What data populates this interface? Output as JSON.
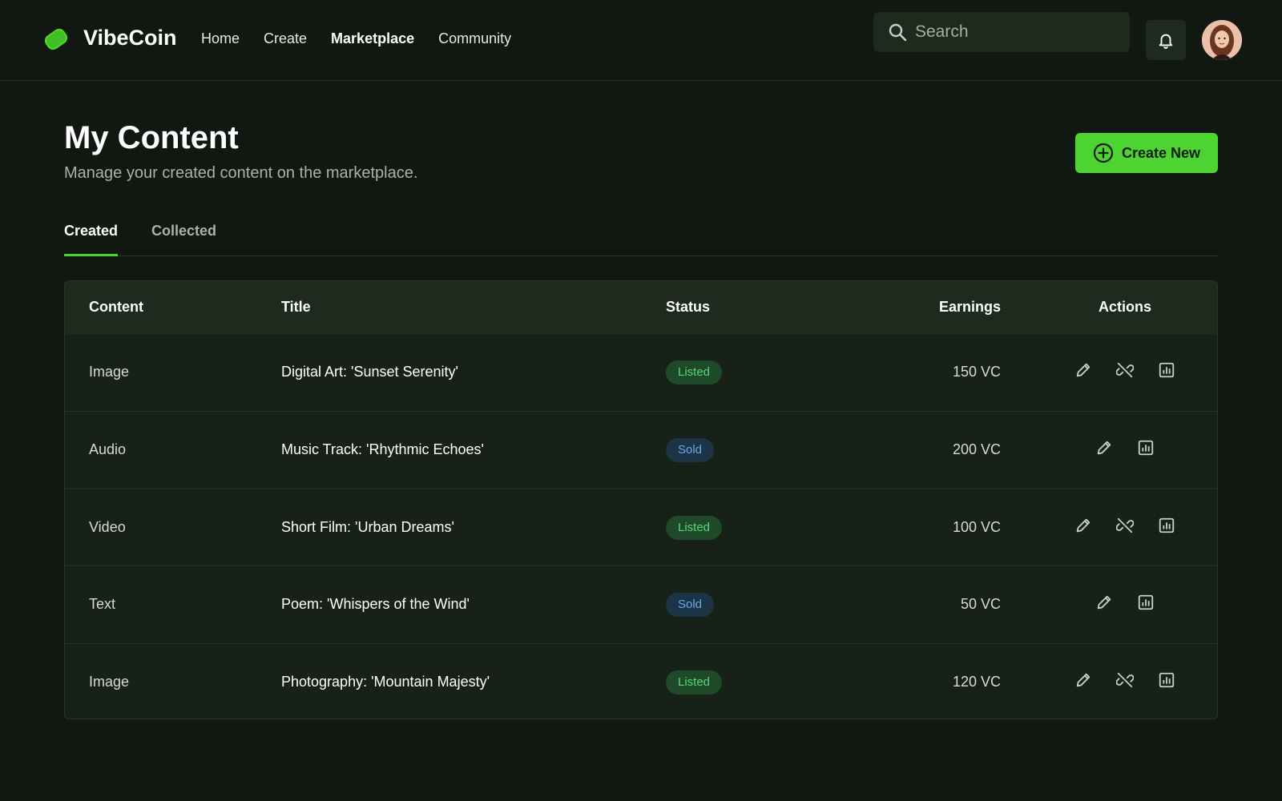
{
  "header": {
    "brand": "VibeCoin",
    "nav": [
      "Home",
      "Create",
      "Marketplace",
      "Community"
    ],
    "active_nav": "Marketplace",
    "search_placeholder": "Search"
  },
  "page": {
    "title": "My Content",
    "subtitle": "Manage your created content on the marketplace.",
    "create_label": "Create New"
  },
  "tabs": [
    {
      "label": "Created",
      "active": true
    },
    {
      "label": "Collected",
      "active": false
    }
  ],
  "table": {
    "columns": [
      "Content",
      "Title",
      "Status",
      "Earnings",
      "Actions"
    ],
    "rows": [
      {
        "content": "Image",
        "title": "Digital Art: 'Sunset Serenity'",
        "status": "Listed",
        "earnings": "150 VC",
        "actions": [
          "edit",
          "unlist",
          "stats"
        ]
      },
      {
        "content": "Audio",
        "title": "Music Track: 'Rhythmic Echoes'",
        "status": "Sold",
        "earnings": "200 VC",
        "actions": [
          "edit",
          "stats"
        ]
      },
      {
        "content": "Video",
        "title": "Short Film: 'Urban Dreams'",
        "status": "Listed",
        "earnings": "100 VC",
        "actions": [
          "edit",
          "unlist",
          "stats"
        ]
      },
      {
        "content": "Text",
        "title": "Poem: 'Whispers of the Wind'",
        "status": "Sold",
        "earnings": "50 VC",
        "actions": [
          "edit",
          "stats"
        ]
      },
      {
        "content": "Image",
        "title": "Photography: 'Mountain Majesty'",
        "status": "Listed",
        "earnings": "120 VC",
        "actions": [
          "edit",
          "unlist",
          "stats"
        ]
      }
    ]
  },
  "icons": {
    "logo": "vibecoin-logo-icon",
    "search": "search-icon",
    "bell": "bell-icon",
    "create": "plus-circle-icon",
    "edit": "pencil-icon",
    "unlist": "link-off-icon",
    "stats": "chart-icon"
  },
  "colors": {
    "background": "#111811",
    "accent": "#4ed430",
    "listed_badge_bg": "#1f4a2a",
    "listed_badge_text": "#58d678",
    "sold_badge_bg": "#1d3447",
    "sold_badge_text": "#64a9e6"
  }
}
